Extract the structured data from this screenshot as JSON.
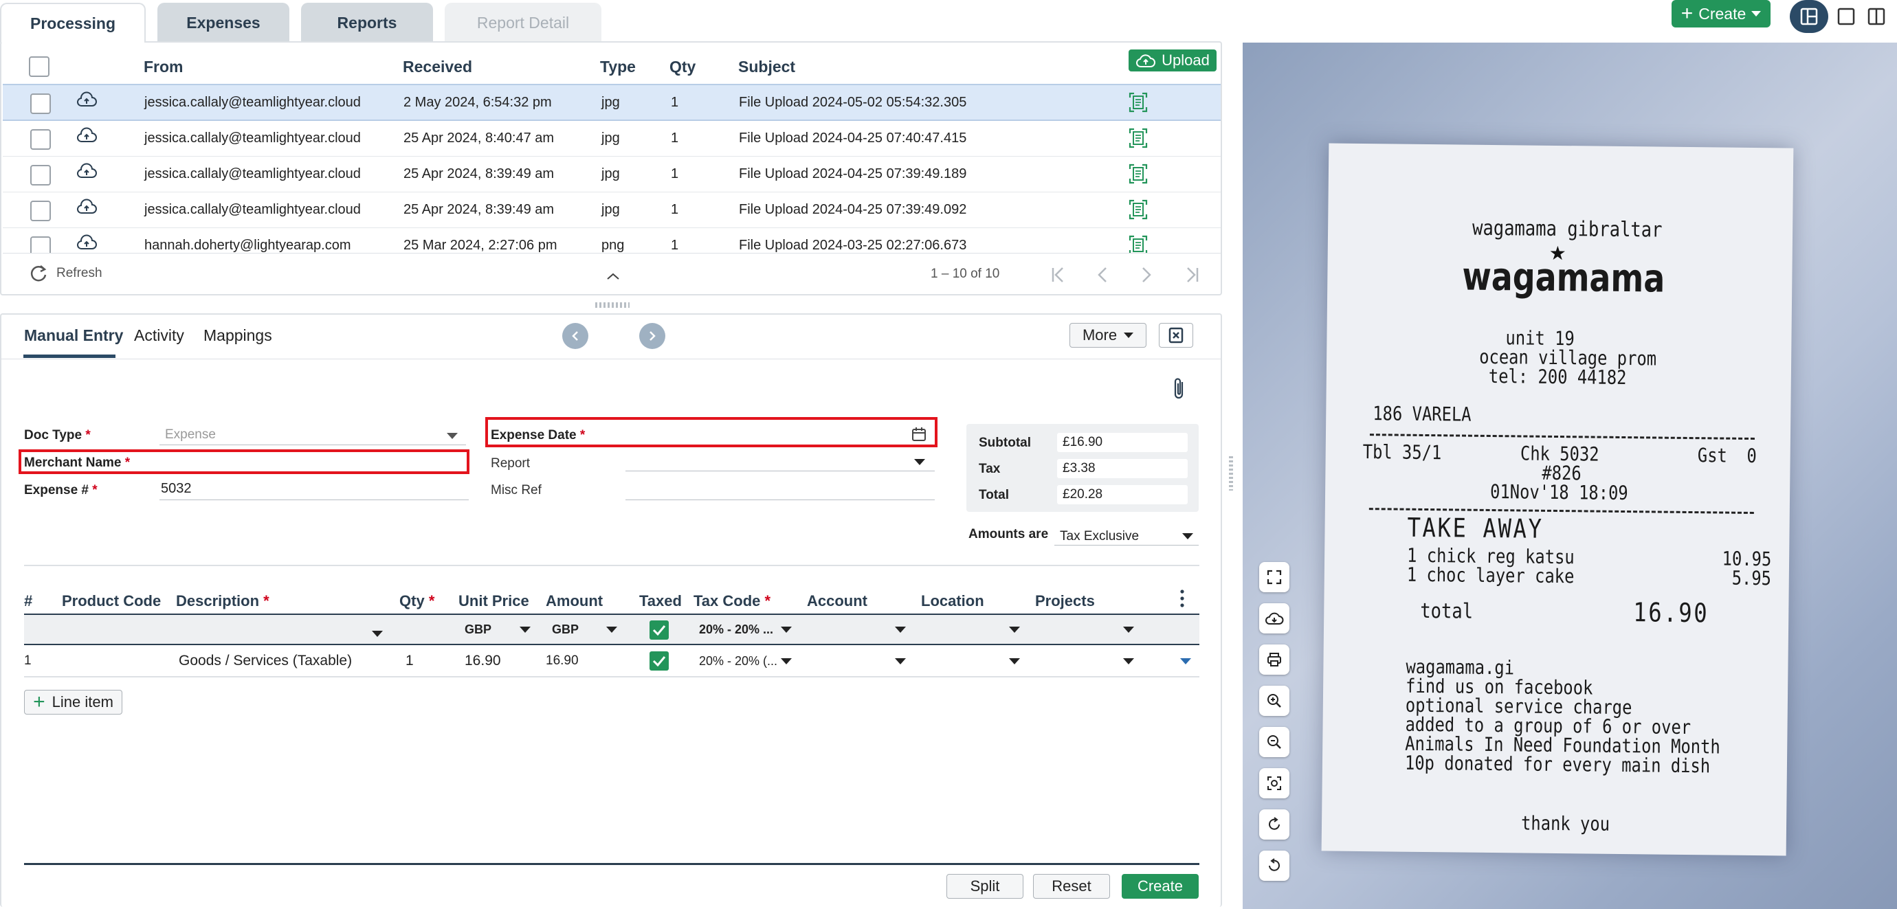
{
  "tabs": [
    {
      "label": "Processing"
    },
    {
      "label": "Expenses"
    },
    {
      "label": "Reports"
    },
    {
      "label": "Report Detail"
    }
  ],
  "top_actions": {
    "create_label": "Create"
  },
  "grid": {
    "headers": {
      "from": "From",
      "received": "Received",
      "type": "Type",
      "qty": "Qty",
      "subject": "Subject"
    },
    "upload_label": "Upload",
    "rows": [
      {
        "from": "jessica.callaly@teamlightyear.cloud",
        "received": "2 May 2024, 6:54:32 pm",
        "type": "jpg",
        "qty": "1",
        "subject": "File Upload 2024-05-02 05:54:32.305"
      },
      {
        "from": "jessica.callaly@teamlightyear.cloud",
        "received": "25 Apr 2024, 8:40:47 am",
        "type": "jpg",
        "qty": "1",
        "subject": "File Upload 2024-04-25 07:40:47.415"
      },
      {
        "from": "jessica.callaly@teamlightyear.cloud",
        "received": "25 Apr 2024, 8:39:49 am",
        "type": "jpg",
        "qty": "1",
        "subject": "File Upload 2024-04-25 07:39:49.189"
      },
      {
        "from": "jessica.callaly@teamlightyear.cloud",
        "received": "25 Apr 2024, 8:39:49 am",
        "type": "jpg",
        "qty": "1",
        "subject": "File Upload 2024-04-25 07:39:49.092"
      },
      {
        "from": "hannah.doherty@lightyearap.com",
        "received": "25 Mar 2024, 2:27:06 pm",
        "type": "png",
        "qty": "1",
        "subject": "File Upload 2024-03-25 02:27:06.673"
      }
    ],
    "refresh_label": "Refresh",
    "pagination": "1 – 10 of 10"
  },
  "detail": {
    "tabs": [
      "Manual Entry",
      "Activity",
      "Mappings"
    ],
    "more_label": "More",
    "doc_type": {
      "label": "Doc Type",
      "value": "Expense"
    },
    "merchant_name": {
      "label": "Merchant Name",
      "value": ""
    },
    "expense_num": {
      "label": "Expense #",
      "value": "5032"
    },
    "expense_date": {
      "label": "Expense Date",
      "value": ""
    },
    "report": {
      "label": "Report",
      "value": ""
    },
    "misc_ref": {
      "label": "Misc Ref",
      "value": ""
    },
    "req_star": "*",
    "totals": {
      "subtotal_label": "Subtotal",
      "subtotal": "£16.90",
      "tax_label": "Tax",
      "tax": "£3.38",
      "total_label": "Total",
      "total": "£20.28"
    },
    "amounts_are": {
      "label": "Amounts are",
      "value": "Tax Exclusive"
    }
  },
  "lines": {
    "headers": {
      "num": "#",
      "product_code": "Product Code",
      "description": "Description",
      "qty": "Qty",
      "unit_price": "Unit Price",
      "amount": "Amount",
      "taxed": "Taxed",
      "tax_code": "Tax Code",
      "account": "Account",
      "location": "Location",
      "projects": "Projects"
    },
    "filter": {
      "unit_price": "GBP",
      "amount": "GBP",
      "tax_code": "20% - 20% ..."
    },
    "rows": [
      {
        "num": "1",
        "description": "Goods / Services (Taxable)",
        "qty": "1",
        "unit_price": "16.90",
        "amount": "16.90",
        "tax_code": "20% - 20% (..."
      }
    ],
    "add_line_label": "Line item"
  },
  "actions": {
    "split": "Split",
    "reset": "Reset",
    "create": "Create"
  },
  "receipt": {
    "lines": [
      "wagamama gibraltar",
      "wagamama",
      "unit 19",
      "ocean village prom",
      "tel: 200 44182",
      "186 VARELA",
      "Tbl 35/1        Chk 5032          Gst  0",
      "#826",
      "01Nov'18 18:09",
      "TAKE AWAY",
      "1 chick reg katsu               10.95",
      "1 choc layer cake                5.95",
      "total",
      "16.90",
      "wagamama.gi",
      "find us on facebook",
      "optional service charge",
      "added to a group of 6 or over",
      "Animals In Need Foundation Month",
      "10p donated for every main dish",
      "thank you"
    ]
  },
  "colors": {
    "accent_green": "#23955a",
    "red_highlight": "#e3141d",
    "navy": "#2b3e50"
  }
}
